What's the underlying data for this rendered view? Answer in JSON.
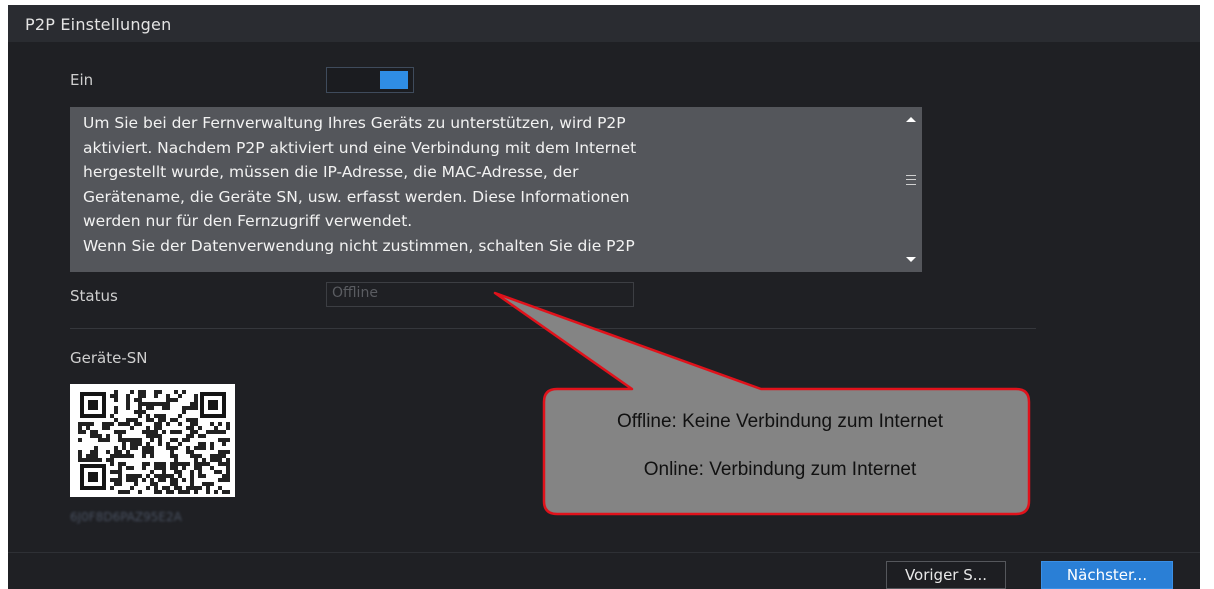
{
  "window": {
    "title": "P2P Einstellungen"
  },
  "enable": {
    "label": "Ein",
    "state": "on"
  },
  "description": {
    "lines": [
      "Um Sie bei der Fernverwaltung Ihres Geräts zu unterstützen, wird P2P",
      "aktiviert. Nachdem P2P aktiviert und eine Verbindung mit dem Internet",
      "hergestellt wurde, müssen die IP-Adresse, die MAC-Adresse, der",
      "Gerätename, die Geräte SN, usw. erfasst werden. Diese Informationen",
      "werden nur für den Fernzugriff verwendet.",
      "Wenn Sie der Datenverwendung nicht zustimmen, schalten Sie die P2P"
    ]
  },
  "status": {
    "label": "Status",
    "value": "Offline"
  },
  "device_sn": {
    "label": "Geräte-SN",
    "serial": "6J0F8D6PAZ95E2A"
  },
  "footer": {
    "prev_label": "Voriger S...",
    "next_label": "Nächster..."
  },
  "callout": {
    "line1": "Offline: Keine Verbindung zum Internet",
    "line2": "Online: Verbindung zum Internet",
    "fill": "#848484",
    "border": "#e0121b"
  },
  "colors": {
    "background": "#1f2024",
    "accent": "#2f8de4"
  }
}
